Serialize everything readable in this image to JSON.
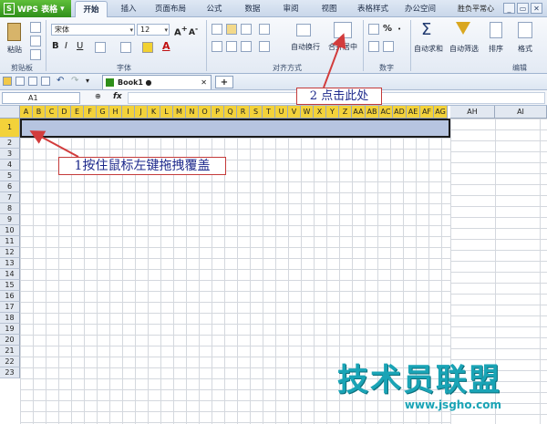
{
  "app": {
    "logo_label": "WPS 表格"
  },
  "menu": {
    "tabs": [
      "开始",
      "插入",
      "页面布局",
      "公式",
      "数据",
      "审阅",
      "视图",
      "表格样式",
      "办公空间"
    ],
    "active_tab": "开始",
    "right_text": "胜负平常心"
  },
  "ribbon": {
    "paste_label": "粘贴",
    "clipboard_label": "剪贴板",
    "font_name": "宋体",
    "font_size": "12",
    "font_group_label": "字体",
    "align_group_label": "对齐方式",
    "wrap_label": "自动换行",
    "merge_label": "合并居中",
    "number_group_label": "数字",
    "sum_label": "自动求和",
    "filter_label": "自动筛选",
    "sort_label": "排序",
    "format_label": "格式",
    "edit_group_label": "编辑",
    "percent_symbol": "%"
  },
  "document": {
    "tab_title": "Book1",
    "new_tab_symbol": "+"
  },
  "formula": {
    "cell_ref": "A1",
    "fx": "fx"
  },
  "sheet": {
    "columns": [
      "A",
      "B",
      "C",
      "D",
      "E",
      "F",
      "G",
      "H",
      "I",
      "J",
      "K",
      "L",
      "M",
      "N",
      "O",
      "P",
      "Q",
      "R",
      "S",
      "T",
      "U",
      "V",
      "W",
      "X",
      "Y",
      "Z",
      "AA",
      "AB",
      "AC",
      "AD",
      "AE",
      "AF",
      "AG"
    ],
    "extra_columns": [
      "AH",
      "AI"
    ],
    "rows": [
      "1",
      "2",
      "3",
      "4",
      "5",
      "6",
      "7",
      "8",
      "9",
      "10",
      "11",
      "12",
      "13",
      "14",
      "15",
      "16",
      "17",
      "18",
      "19",
      "20",
      "21",
      "22",
      "23"
    ],
    "selected_row": "1"
  },
  "annotations": {
    "step1": "1按住鼠标左键拖拽覆盖",
    "step2": "2  点击此处"
  },
  "watermark": {
    "title": "技术员联盟",
    "url": "www.jsgho.com"
  },
  "colors": {
    "selection_header": "#f3d23a",
    "selection_fill": "#b6c4e0",
    "annotation_border": "#c43a3a",
    "watermark": "#1aa4b6"
  }
}
